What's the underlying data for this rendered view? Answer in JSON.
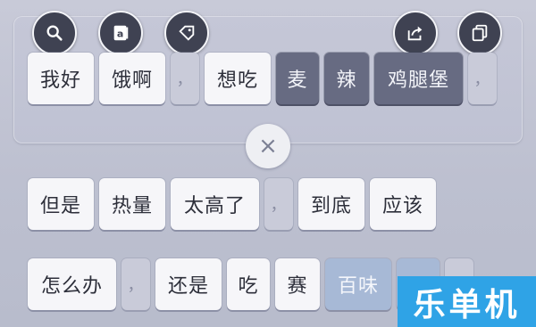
{
  "toolbar": {
    "left_icons": [
      "search-icon",
      "text-a-icon",
      "tag-icon"
    ],
    "right_icons": [
      "share-icon",
      "copy-icon"
    ]
  },
  "row1": [
    "我好",
    "饿啊",
    "，",
    "想吃",
    "麦",
    "辣",
    "鸡腿堡",
    "，"
  ],
  "row2": [
    "但是",
    "热量",
    "太高了",
    "，",
    "到底",
    "应该"
  ],
  "row3": [
    "怎么办",
    "，",
    "还是",
    "吃",
    "赛",
    "百味",
    "呢",
    "，"
  ],
  "close_label": "×",
  "watermark": "乐单机",
  "colors": {
    "selected_chip": "#676b82",
    "chip": "#f6f6f9",
    "toolbar_button": "#3f4252",
    "watermark_bg": "#2fa3e6"
  }
}
